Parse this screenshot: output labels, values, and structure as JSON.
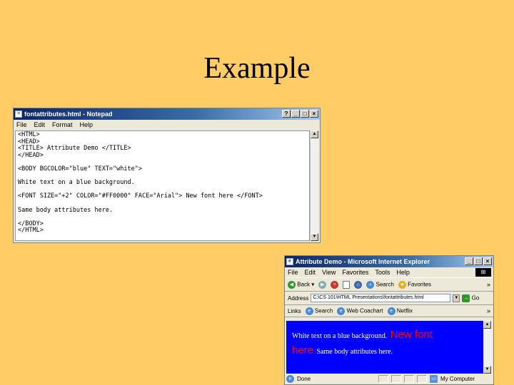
{
  "slide": {
    "title": "Example"
  },
  "notepad": {
    "title": "fontattributes.html - Notepad",
    "menu": [
      "File",
      "Edit",
      "Format",
      "Help"
    ],
    "lines": [
      "<HTML>",
      "<HEAD>",
      "<TITLE> Attribute Demo </TITLE>",
      "</HEAD>",
      "",
      "<BODY BGCOLOR=\"blue\" TEXT=\"white\">",
      "",
      "White text on a blue background.",
      "",
      "<FONT SIZE=\"+2\" COLOR=\"#FF0000\" FACE=\"Arial\"> New font here </FONT>",
      "",
      "Same body attributes here.",
      "",
      "</BODY>",
      "</HTML>"
    ]
  },
  "ie": {
    "title": "Attribute Demo - Microsoft Internet Explorer",
    "menu": [
      "File",
      "Edit",
      "View",
      "Favorites",
      "Tools",
      "Help"
    ],
    "toolbar": {
      "back": "Back",
      "search": "Search",
      "favorites": "Favorites"
    },
    "address": {
      "label": "Address",
      "value": "C:\\CS 101\\HTML Presentations\\fontattributes.html",
      "go": "Go"
    },
    "links": {
      "label": "Links",
      "items": [
        "Search",
        "Web Coachart",
        "Netflix"
      ]
    },
    "content": {
      "white_text_1": "White text on a blue background.",
      "red_line1": "New font",
      "red_line2": "here",
      "white_text_2": "Same body attributes here."
    },
    "status": {
      "left": "Done",
      "right": "My Computer"
    }
  },
  "colors": {
    "slide_bg": "#ffcc66",
    "page_bg": "#0000ff",
    "red_font": "#ff0000",
    "titlebar": "#0a246a"
  }
}
